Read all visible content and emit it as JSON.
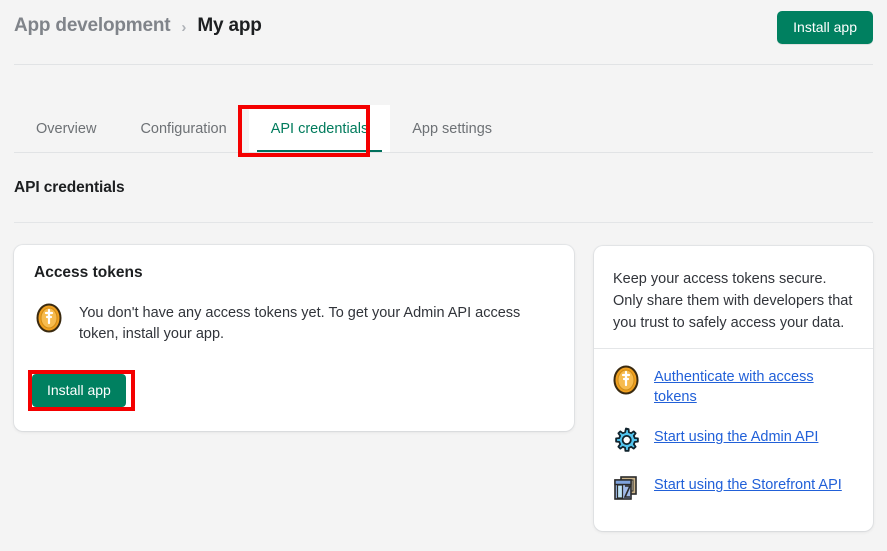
{
  "header": {
    "breadcrumb_parent": "App development",
    "breadcrumb_separator": "›",
    "breadcrumb_current": "My app",
    "install_button": "Install app"
  },
  "tabs": [
    {
      "label": "Overview",
      "active": false
    },
    {
      "label": "Configuration",
      "active": false
    },
    {
      "label": "API credentials",
      "active": true
    },
    {
      "label": "App settings",
      "active": false
    }
  ],
  "section": {
    "title": "API credentials"
  },
  "access_tokens_card": {
    "title": "Access tokens",
    "icon": "token-coin-icon",
    "body": "You don't have any access tokens yet. To get your Admin API access token, install your app.",
    "install_button": "Install app"
  },
  "sidebar_card": {
    "note": "Keep your access tokens secure. Only share them with developers that you trust to safely access your data.",
    "links": [
      {
        "label": "Authenticate with access tokens",
        "icon": "token-coin-icon"
      },
      {
        "label": "Start using the Admin API",
        "icon": "gear-icon"
      },
      {
        "label": "Start using the Storefront API",
        "icon": "storefront-icon"
      }
    ]
  },
  "annotations": {
    "tab_highlight": "API credentials",
    "button_highlight": "Install app",
    "color": "#f40000"
  },
  "colors": {
    "brand_green": "#008060",
    "tab_active_text": "#007b5c",
    "link_blue": "#2160d8",
    "page_background": "#f4f4f4"
  }
}
